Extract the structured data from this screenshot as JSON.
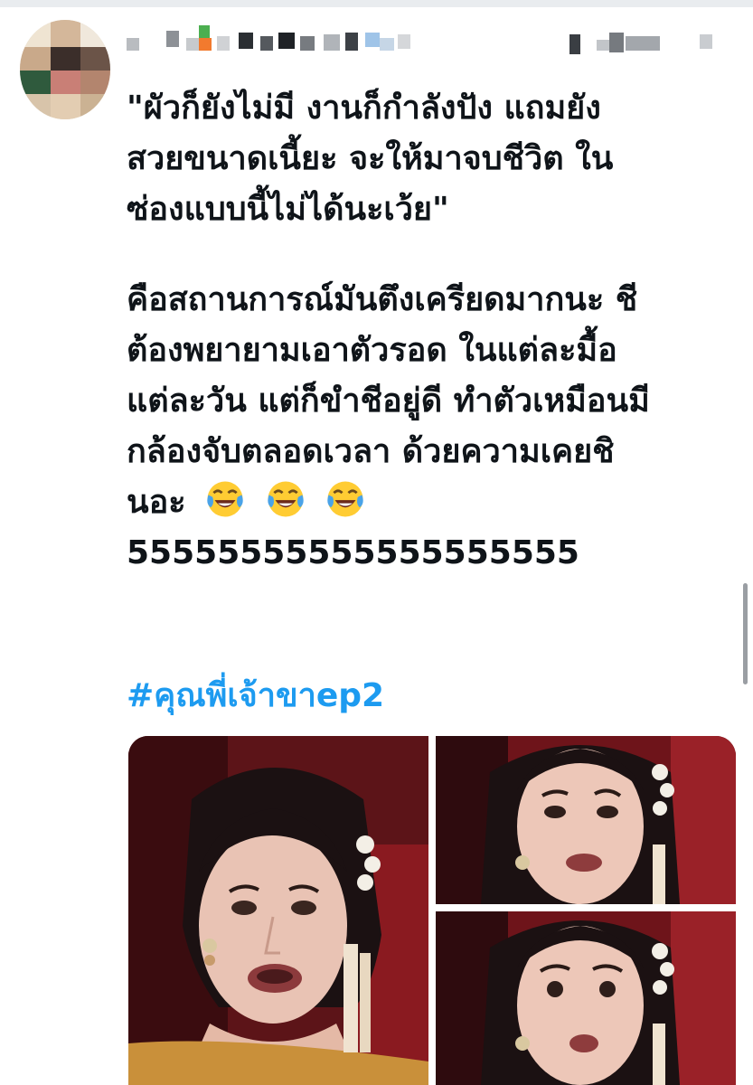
{
  "tweet": {
    "lines": [
      "\"ผัวก็ยังไม่มี งานก็กำลังปัง แถมยัง",
      "สวยขนาดเนี้ยะ จะให้มาจบชีวิต ใน",
      "ซ่องแบบนี้ไม่ได้นะเว้ย\"",
      "คือสถานการณ์มันตึงเครียดมากนะ ชี",
      "ต้องพยายามเอาตัวรอด ในแต่ละมื้อ",
      "แต่ละวัน แต่ก็ขำชีอยู่ดี ทำตัวเหมือนมี",
      "กล้องจับตลอดเวลา ด้วยความเคยชิ",
      "นอะ",
      "55555555555555555555"
    ],
    "emojis": [
      "face-with-tears-of-joy-icon",
      "face-with-tears-of-joy-icon",
      "face-with-tears-of-joy-icon"
    ],
    "hashtag": "#คุณพี่เจ้าขาep2"
  },
  "media": {
    "count": 3,
    "items": [
      "photo",
      "photo",
      "photo"
    ]
  },
  "colors": {
    "text": "#0f1419",
    "link": "#1d9bf0",
    "background": "#ffffff"
  }
}
